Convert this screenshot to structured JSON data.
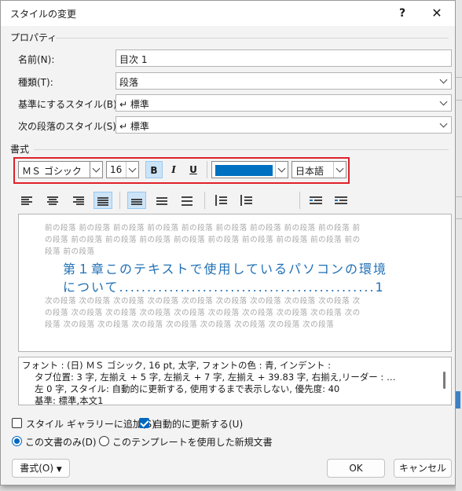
{
  "window": {
    "title": "スタイルの変更",
    "help": "?",
    "close": "✕"
  },
  "properties": {
    "section": "プロパティ",
    "name_label": "名前(N):",
    "name_value": "目次 1",
    "type_label": "種類(T):",
    "type_value": "段落",
    "based_label": "基準にするスタイル(B):",
    "based_value": "↵ 標準",
    "next_label": "次の段落のスタイル(S):",
    "next_value": "↵ 標準"
  },
  "format": {
    "section": "書式",
    "font": "ＭＳ ゴシック",
    "size": "16",
    "bold": "B",
    "italic": "I",
    "underline": "U",
    "color": "#0070c0",
    "language": "日本語"
  },
  "preview": {
    "prev_line1": "前の段落 前の段落 前の段落 前の段落 前の段落 前の段落 前の段落 前の段落 前の段落 前",
    "prev_line2": "の段落 前の段落 前の段落 前の段落 前の段落 前の段落 前の段落 前の段落 前の段落 前の",
    "prev_line3": "段落 前の段落",
    "heading_line1": "第１章このテキストで使用しているパソコンの環境",
    "heading_line2": "について..............................................1",
    "next_line1": "次の段落 次の段落 次の段落 次の段落 次の段落 次の段落 次の段落 次の段落 次の段落 次",
    "next_line2": "の段落 次の段落 次の段落 次の段落 次の段落 次の段落 次の段落 次の段落 次の段落 次の",
    "next_line3": "段落 次の段落 次の段落 次の段落 次の段落 次の段落 次の段落 次の段落 次の段落"
  },
  "description": {
    "line1": "フォント : (日) ＭＳ ゴシック, 16 pt, 太字, フォントの色 : 青, インデント :",
    "line2": "タブ位置:  3 字, 左揃え +  5 字, 左揃え +  7 字, 左揃え +  39.83 字, 右揃え,リーダー : …",
    "line3": "左  0 字, スタイル: 自動的に更新する, 使用するまで表示しない, 優先度: 40",
    "line4": "基準: 標準,本文1"
  },
  "options": {
    "add_gallery": "スタイル ギャラリーに追加(S)",
    "auto_update": "自動的に更新する(U)",
    "this_doc": "この文書のみ(D)",
    "new_docs": "このテンプレートを使用した新規文書"
  },
  "buttons": {
    "format": "書式(O)",
    "ok": "OK",
    "cancel": "キャンセル"
  }
}
